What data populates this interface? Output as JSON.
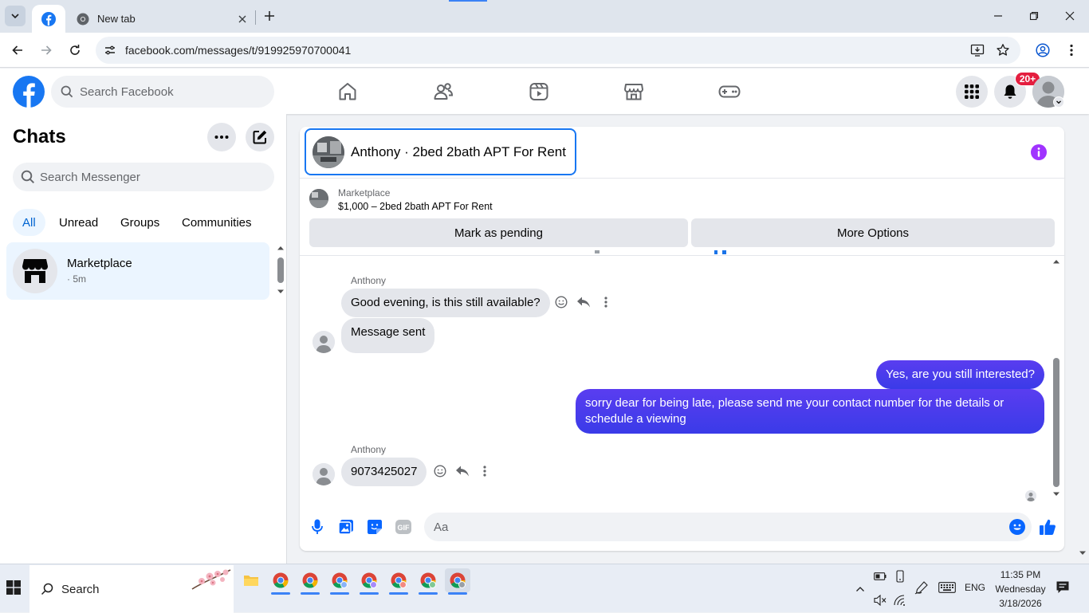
{
  "browser": {
    "tabs": [
      {
        "title": "",
        "icon": "facebook-icon",
        "active": true
      },
      {
        "title": "New tab",
        "icon": "chrome-icon",
        "active": false
      }
    ],
    "url": "facebook.com/messages/t/919925970700041"
  },
  "header": {
    "search_placeholder": "Search Facebook",
    "notification_badge": "20+"
  },
  "sidebar": {
    "title": "Chats",
    "search_placeholder": "Search Messenger",
    "filters": [
      "All",
      "Unread",
      "Groups",
      "Communities"
    ],
    "chats": [
      {
        "name": "Marketplace",
        "time": "· 5m"
      }
    ]
  },
  "conversation": {
    "title": "Anthony · 2bed 2bath APT For Rent",
    "marketplace_label": "Marketplace",
    "listing": "$1,000 – 2bed 2bath APT For Rent",
    "actions": [
      "Mark as pending",
      "More Options"
    ],
    "messages": [
      {
        "sender": "Anthony",
        "text": "Good evening, is this still available?",
        "direction": "in"
      },
      {
        "sender": "",
        "text": "Message sent",
        "direction": "in"
      },
      {
        "sender": "",
        "text": "Yes, are you still interested?",
        "direction": "out"
      },
      {
        "sender": "",
        "text": "sorry dear for being late, please send me your contact number for the details or schedule a viewing",
        "direction": "out"
      },
      {
        "sender": "Anthony",
        "text": "9073425027",
        "direction": "in"
      }
    ],
    "composer_placeholder": "Aa"
  },
  "taskbar": {
    "search_label": "Search",
    "language": "ENG",
    "time": "11:35 PM",
    "day": "Wednesday",
    "date": "3/18/2026"
  },
  "colors": {
    "facebook_blue": "#1877f2",
    "outgoing_bubble": "#4a3cf0",
    "badge_red": "#e41e3f",
    "info_purple": "#a033ff"
  }
}
